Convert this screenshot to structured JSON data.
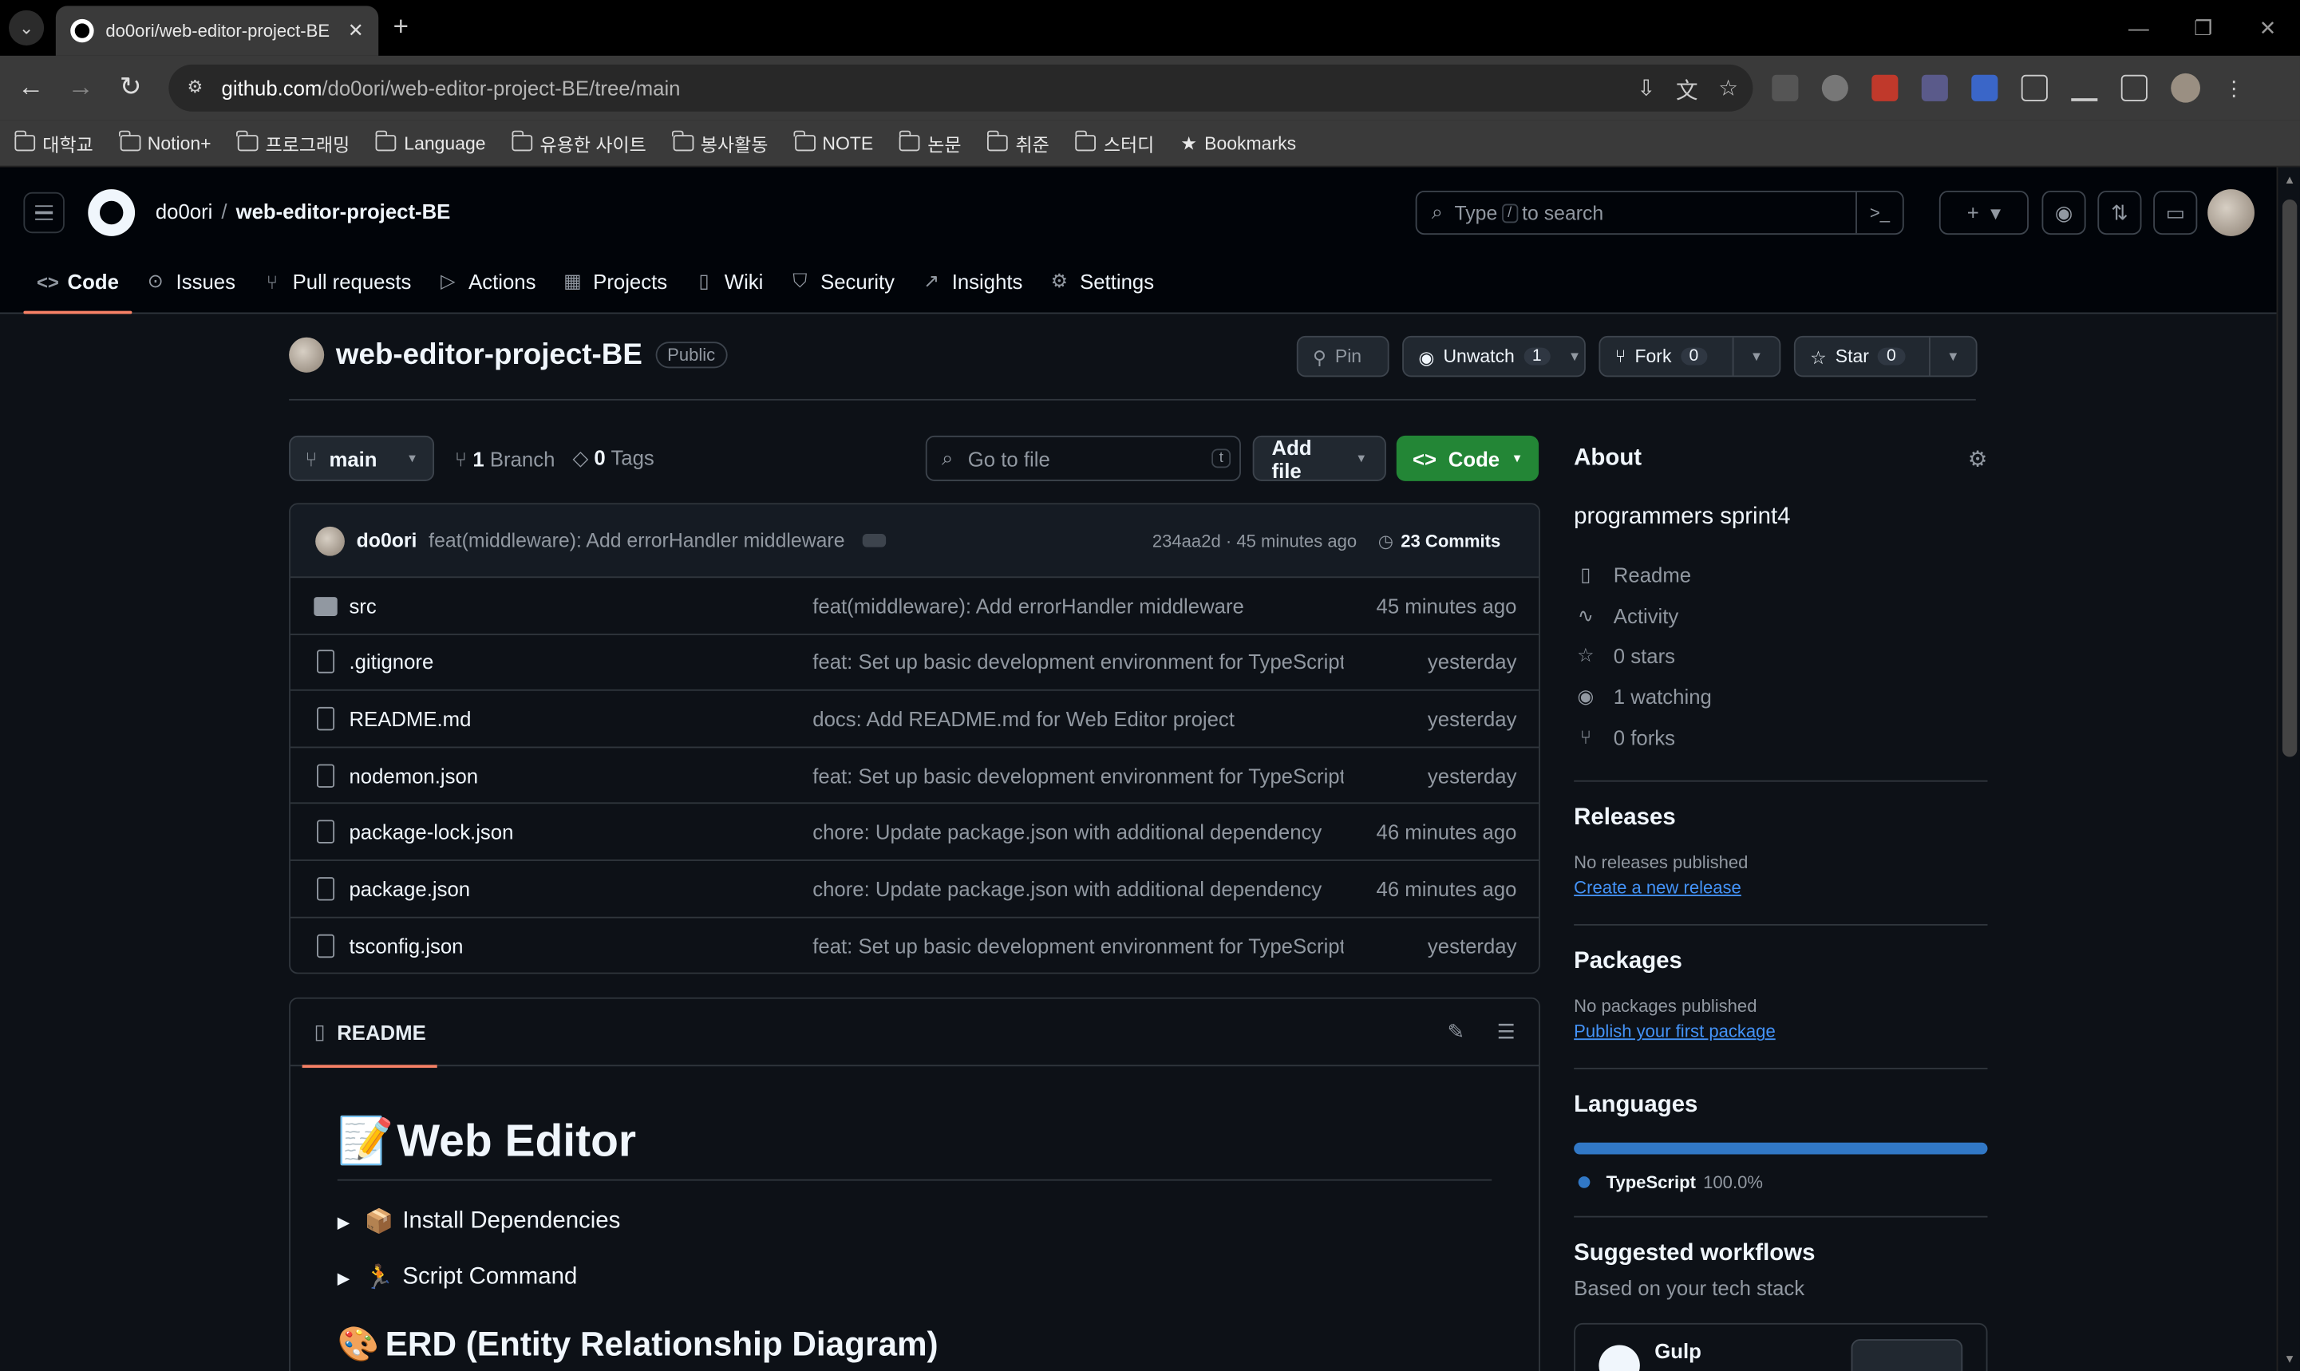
{
  "browser": {
    "tab_title": "do0ori/web-editor-project-BE",
    "tab_close": "✕",
    "new_tab": "+",
    "url_host": "github.com",
    "url_path": "/do0ori/web-editor-project-BE/tree/main",
    "bookmarks": [
      "대학교",
      "Notion+",
      "프로그래밍",
      "Language",
      "유용한 사이트",
      "봉사활동",
      "NOTE",
      "논문",
      "취준",
      "스터디",
      "Bookmarks"
    ]
  },
  "header": {
    "owner": "do0ori",
    "separator": "/",
    "repo": "web-editor-project-BE",
    "search_prefix": "Type",
    "search_key": "/",
    "search_suffix": "to search"
  },
  "repo_nav": [
    {
      "label": "Code",
      "icon": "code-icon"
    },
    {
      "label": "Issues",
      "icon": "issue-icon"
    },
    {
      "label": "Pull requests",
      "icon": "pull-request-icon"
    },
    {
      "label": "Actions",
      "icon": "play-icon"
    },
    {
      "label": "Projects",
      "icon": "table-icon"
    },
    {
      "label": "Wiki",
      "icon": "book-icon"
    },
    {
      "label": "Security",
      "icon": "shield-icon"
    },
    {
      "label": "Insights",
      "icon": "graph-icon"
    },
    {
      "label": "Settings",
      "icon": "gear-icon"
    }
  ],
  "repo": {
    "name": "web-editor-project-BE",
    "visibility": "Public",
    "pin": "Pin",
    "unwatch": "Unwatch",
    "watch_count": "1",
    "fork": "Fork",
    "fork_count": "0",
    "star": "Star",
    "star_count": "0"
  },
  "controls": {
    "branch": "main",
    "branch_count": "1",
    "branch_label": "Branch",
    "tag_count": "0",
    "tag_label": "Tags",
    "goto_placeholder": "Go to file",
    "goto_key": "t",
    "add_file": "Add file",
    "code": "Code"
  },
  "latest_commit": {
    "author": "do0ori",
    "message": "feat(middleware): Add errorHandler middleware",
    "sha_time": "234aa2d · 45 minutes ago",
    "commits_label": "23 Commits"
  },
  "files": [
    {
      "name": "src",
      "type": "dir",
      "message": "feat(middleware): Add errorHandler middleware",
      "date": "45 minutes ago"
    },
    {
      "name": ".gitignore",
      "type": "file",
      "message": "feat: Set up basic development environment for TypeScript-...",
      "date": "yesterday"
    },
    {
      "name": "README.md",
      "type": "file",
      "message": "docs: Add README.md for Web Editor project",
      "date": "yesterday"
    },
    {
      "name": "nodemon.json",
      "type": "file",
      "message": "feat: Set up basic development environment for TypeScript-...",
      "date": "yesterday"
    },
    {
      "name": "package-lock.json",
      "type": "file",
      "message": "chore: Update package.json with additional dependency",
      "date": "46 minutes ago"
    },
    {
      "name": "package.json",
      "type": "file",
      "message": "chore: Update package.json with additional dependency",
      "date": "46 minutes ago"
    },
    {
      "name": "tsconfig.json",
      "type": "file",
      "message": "feat: Set up basic development environment for TypeScript-...",
      "date": "yesterday"
    }
  ],
  "readme": {
    "tab": "README",
    "h1": "Web Editor",
    "details": [
      "Install Dependencies",
      "Script Command"
    ],
    "h2": "ERD (Entity Relationship Diagram)"
  },
  "sidebar": {
    "about_title": "About",
    "description": "programmers sprint4",
    "links": [
      {
        "label": "Readme",
        "icon": "book-icon"
      },
      {
        "label": "Activity",
        "icon": "pulse-icon"
      },
      {
        "label": "0 stars",
        "icon": "star-icon"
      },
      {
        "label": "1 watching",
        "icon": "eye-icon"
      },
      {
        "label": "0 forks",
        "icon": "fork-icon"
      }
    ],
    "releases_title": "Releases",
    "releases_text": "No releases published",
    "releases_link": "Create a new release",
    "packages_title": "Packages",
    "packages_text": "No packages published",
    "packages_link": "Publish your first package",
    "languages_title": "Languages",
    "language_name": "TypeScript",
    "language_pct": "100.0%",
    "language_fraction": 1.0,
    "language_color": "#3178c6",
    "workflows_title": "Suggested workflows",
    "workflows_sub": "Based on your tech stack",
    "workflow_card_name": "Gulp"
  },
  "colors": {
    "accent_tab": "#f78166",
    "code_button": "#238636",
    "link": "#4493f8"
  }
}
